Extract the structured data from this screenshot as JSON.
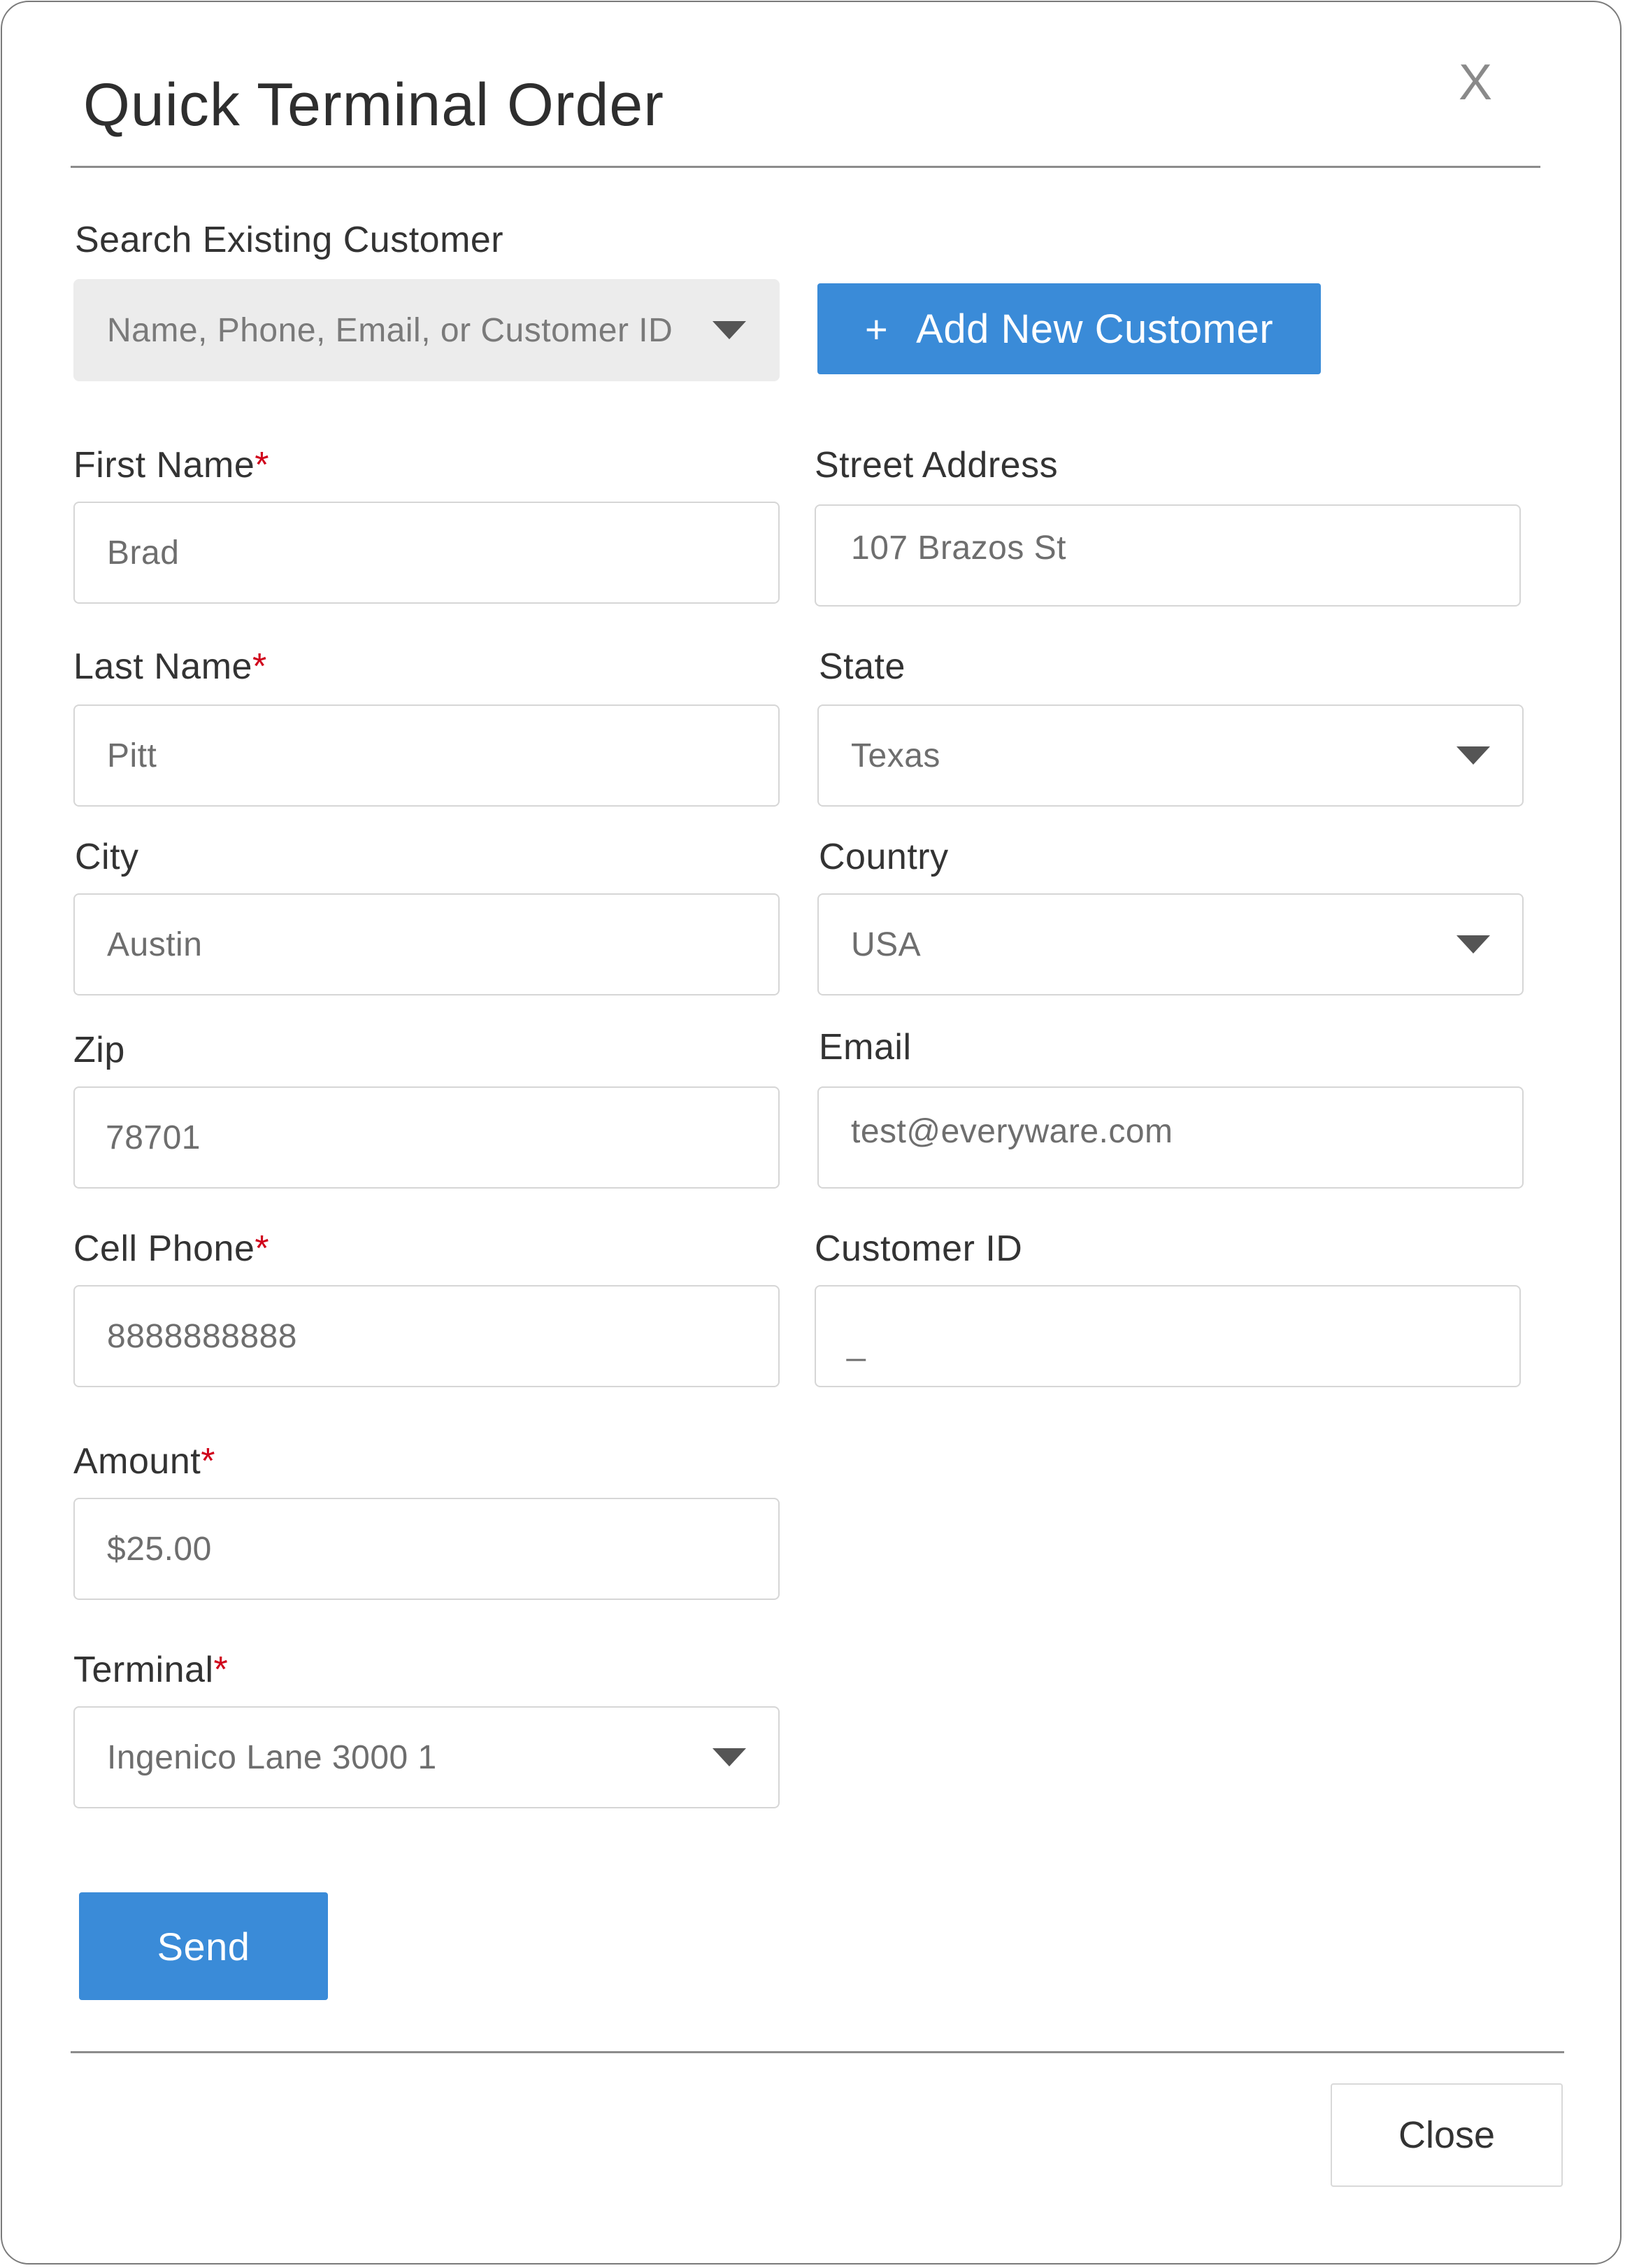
{
  "dialog": {
    "title": "Quick Terminal Order",
    "close_icon_glyph": "X"
  },
  "search": {
    "label": "Search Existing Customer",
    "placeholder": "Name, Phone, Email, or Customer ID"
  },
  "add_customer": {
    "icon": "+",
    "label": "Add New Customer"
  },
  "fields": {
    "first_name": {
      "label": "First Name",
      "required": "*",
      "value": "Brad"
    },
    "last_name": {
      "label": "Last Name",
      "required": "*",
      "value": "Pitt"
    },
    "city": {
      "label": "City",
      "value": "Austin"
    },
    "zip": {
      "label": "Zip",
      "value": "78701"
    },
    "cell_phone": {
      "label": "Cell Phone",
      "required": "*",
      "value": "8888888888"
    },
    "amount": {
      "label": "Amount",
      "required": "*",
      "value": "$25.00"
    },
    "terminal": {
      "label": "Terminal",
      "required": "*",
      "value": "Ingenico Lane 3000 1"
    },
    "street_address": {
      "label": "Street Address",
      "value": "107 Brazos St"
    },
    "state": {
      "label": "State",
      "value": "Texas"
    },
    "country": {
      "label": "Country",
      "value": "USA"
    },
    "email": {
      "label": "Email",
      "value": "test@everyware.com"
    },
    "customer_id": {
      "label": "Customer ID",
      "value": "_"
    }
  },
  "actions": {
    "send_label": "Send",
    "close_label": "Close"
  },
  "colors": {
    "primary": "#3a8bd8",
    "required": "#d0021b",
    "border": "#d6d6d6"
  }
}
